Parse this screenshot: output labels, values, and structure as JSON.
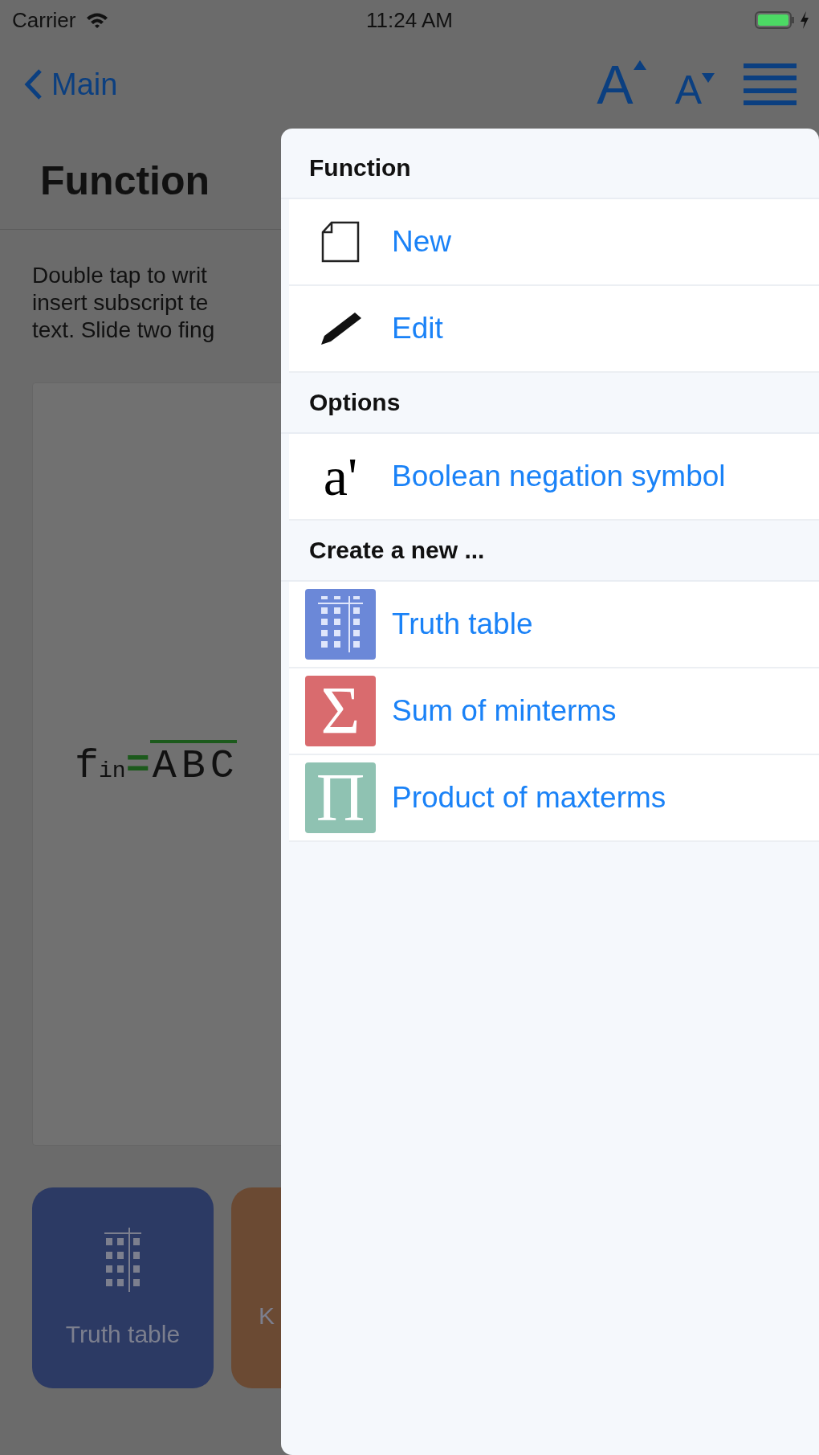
{
  "status_bar": {
    "carrier": "Carrier",
    "time": "11:24 AM",
    "battery_charging": true
  },
  "nav": {
    "back": "Main",
    "buttons": [
      {
        "kind": "bigger",
        "label": "A"
      },
      {
        "kind": "smaller",
        "label": "A"
      },
      {
        "kind": "menu"
      }
    ]
  },
  "title": "Function",
  "instructions": [
    "Double tap to writ",
    "insert subscript te",
    "text. Slide two fing"
  ],
  "formula": {
    "name": "f",
    "subscript": "in",
    "equals": "=",
    "terms": [
      {
        "letter": "A",
        "negated": true
      },
      {
        "letter": "B",
        "negated": true
      },
      {
        "letter": "C",
        "negated": true
      }
    ]
  },
  "tiles": [
    {
      "label": "Truth table",
      "color": "#2c3a64",
      "kind": "table"
    },
    {
      "label": "K",
      "color": "#6b4a33",
      "kind": "partial"
    }
  ],
  "popover": {
    "sections": [
      {
        "header": "Function",
        "items": [
          {
            "label": "New",
            "kind": "doc"
          },
          {
            "label": "Edit",
            "kind": "pen"
          }
        ]
      },
      {
        "header": "Options",
        "items": [
          {
            "label": "Boolean negation symbol",
            "kind": "glyph",
            "glyph": "a'"
          }
        ]
      },
      {
        "header": "Create a new ...",
        "items": [
          {
            "label": "Truth table",
            "kind": "table",
            "color": "#6b88d8"
          },
          {
            "label": "Sum of minterms",
            "kind": "glyph",
            "glyph": "Σ",
            "color": "#d96b6e"
          },
          {
            "label": "Product of maxterms",
            "kind": "glyph",
            "glyph": "Π",
            "color": "#8fc2b2"
          }
        ]
      }
    ]
  }
}
